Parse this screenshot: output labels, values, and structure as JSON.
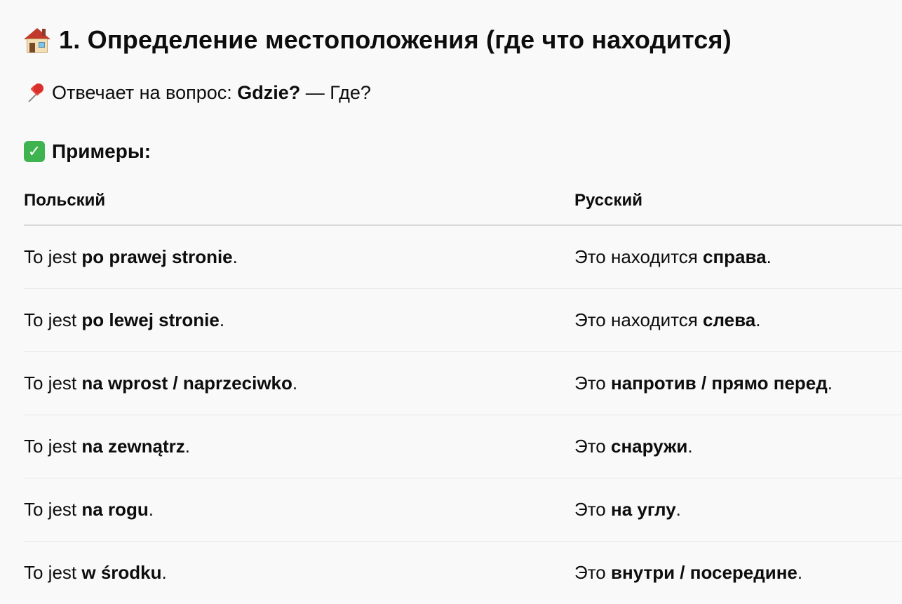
{
  "section": {
    "icon": "house-icon",
    "title": "1. Определение местоположения (где что находится)"
  },
  "question": {
    "icon": "pushpin-icon",
    "prefix": "Отвечает на вопрос: ",
    "word": "Gdzie?",
    "suffix": " — Где?"
  },
  "examples": {
    "icon": "check-mark-icon",
    "title": "Примеры:",
    "check_glyph": "✓"
  },
  "table": {
    "headers": [
      "Польский",
      "Русский"
    ],
    "rows": [
      {
        "pl": {
          "pre": "To jest ",
          "bold": "po prawej stronie",
          "post": "."
        },
        "ru": {
          "pre": "Это находится ",
          "bold": "справа",
          "post": "."
        }
      },
      {
        "pl": {
          "pre": "To jest ",
          "bold": "po lewej stronie",
          "post": "."
        },
        "ru": {
          "pre": "Это находится ",
          "bold": "слева",
          "post": "."
        }
      },
      {
        "pl": {
          "pre": "To jest ",
          "bold": "na wprost / naprzeciwko",
          "post": "."
        },
        "ru": {
          "pre": "Это ",
          "bold": "напротив / прямо перед",
          "post": "."
        }
      },
      {
        "pl": {
          "pre": "To jest ",
          "bold": "na zewnątrz",
          "post": "."
        },
        "ru": {
          "pre": "Это ",
          "bold": "снаружи",
          "post": "."
        }
      },
      {
        "pl": {
          "pre": "To jest ",
          "bold": "na rogu",
          "post": "."
        },
        "ru": {
          "pre": "Это ",
          "bold": "на углу",
          "post": "."
        }
      },
      {
        "pl": {
          "pre": "To jest ",
          "bold": "w środku",
          "post": "."
        },
        "ru": {
          "pre": "Это ",
          "bold": "внутри / посередине",
          "post": "."
        }
      }
    ]
  }
}
